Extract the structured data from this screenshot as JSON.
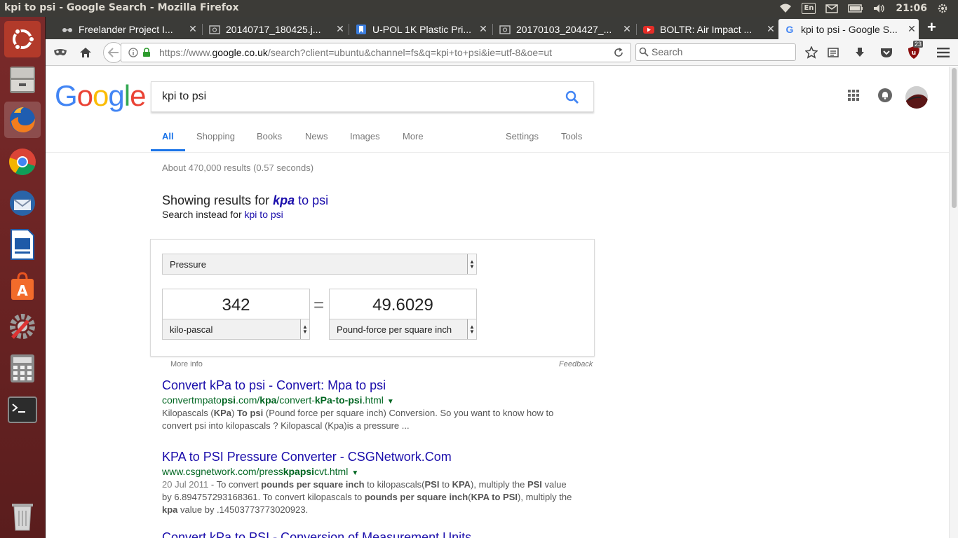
{
  "window": {
    "title": "kpi to psi - Google Search - Mozilla Firefox"
  },
  "tray": {
    "keyboard": "En",
    "clock": "21:06"
  },
  "launcher": {
    "items": [
      "Ubuntu dash",
      "Files",
      "Firefox",
      "Chromium",
      "Thunderbird",
      "LibreOffice Impress",
      "Ubuntu Software",
      "System Settings",
      "Calculator",
      "Terminal",
      "Trash"
    ]
  },
  "tabs": [
    {
      "label": "Freelander Project I...",
      "icon": "glasses-icon"
    },
    {
      "label": "20140717_180425.j...",
      "icon": "image-icon"
    },
    {
      "label": "U-POL 1K Plastic Pri...",
      "icon": "bookmark-icon"
    },
    {
      "label": "20170103_204427_...",
      "icon": "image-icon"
    },
    {
      "label": "BOLTR: Air Impact ...",
      "icon": "youtube-icon"
    },
    {
      "label": "kpi to psi - Google S...",
      "icon": "google-icon"
    }
  ],
  "nav": {
    "url_prefix": "https://www.",
    "url_domain": "google.co.uk",
    "url_rest": "/search?client=ubuntu&channel=fs&q=kpi+to+psi&ie=utf-8&oe=ut",
    "search_placeholder": "Search",
    "badge_count": "23"
  },
  "google": {
    "logo": "Google",
    "query": "kpi to psi",
    "tabs": [
      "All",
      "Shopping",
      "Books",
      "News",
      "Images",
      "More",
      "Settings",
      "Tools"
    ],
    "stats": "About 470,000 results (0.57 seconds)",
    "showing_prefix": "Showing results for ",
    "showing_fix": "kpa",
    "showing_rest": " to psi",
    "instead_prefix": "Search instead for ",
    "instead_link": "kpi to psi"
  },
  "converter": {
    "category": "Pressure",
    "from_value": "342",
    "to_value": "49.6029",
    "from_unit": "kilo-pascal",
    "to_unit": "Pound-force per square inch",
    "equals": "=",
    "more_info": "More info",
    "feedback": "Feedback"
  },
  "results": [
    {
      "title": "Convert kPa to psi - Convert: Mpa to psi",
      "url_parts": [
        "convertmpato",
        "psi",
        ".com/",
        "kpa",
        "/convert-",
        "kPa-to-psi",
        ".html"
      ],
      "snippet_line1": [
        "Kilopascals (",
        "KPa",
        ") ",
        "To psi",
        " (Pound force per square inch) Conversion. So you want to know how to"
      ],
      "snippet_line2": "convert psi into kilopascals ? Kilopascal (Kpa)is a pressure ..."
    },
    {
      "title": "KPA to PSI Pressure Converter - CSGNetwork.Com",
      "url_parts": [
        "www.csgnetwork.com/press",
        "kpapsi",
        "cvt.html"
      ],
      "date": "20 Jul 2011",
      "snippet_line1": [
        " - To convert ",
        "pounds per square inch",
        " to kilopascals(",
        "PSI",
        " to ",
        "KPA",
        "), multiply the ",
        "PSI",
        " value"
      ],
      "snippet_line2": [
        "by 6.894757293168361. To convert kilopascals to ",
        "pounds per square inch",
        "(",
        "KPA to PSI",
        "), multiply the"
      ],
      "snippet_line3": [
        "kpa",
        " value by .14503773773020923."
      ]
    },
    {
      "title": "Convert kPa to PSI - Conversion of Measurement Units"
    }
  ]
}
